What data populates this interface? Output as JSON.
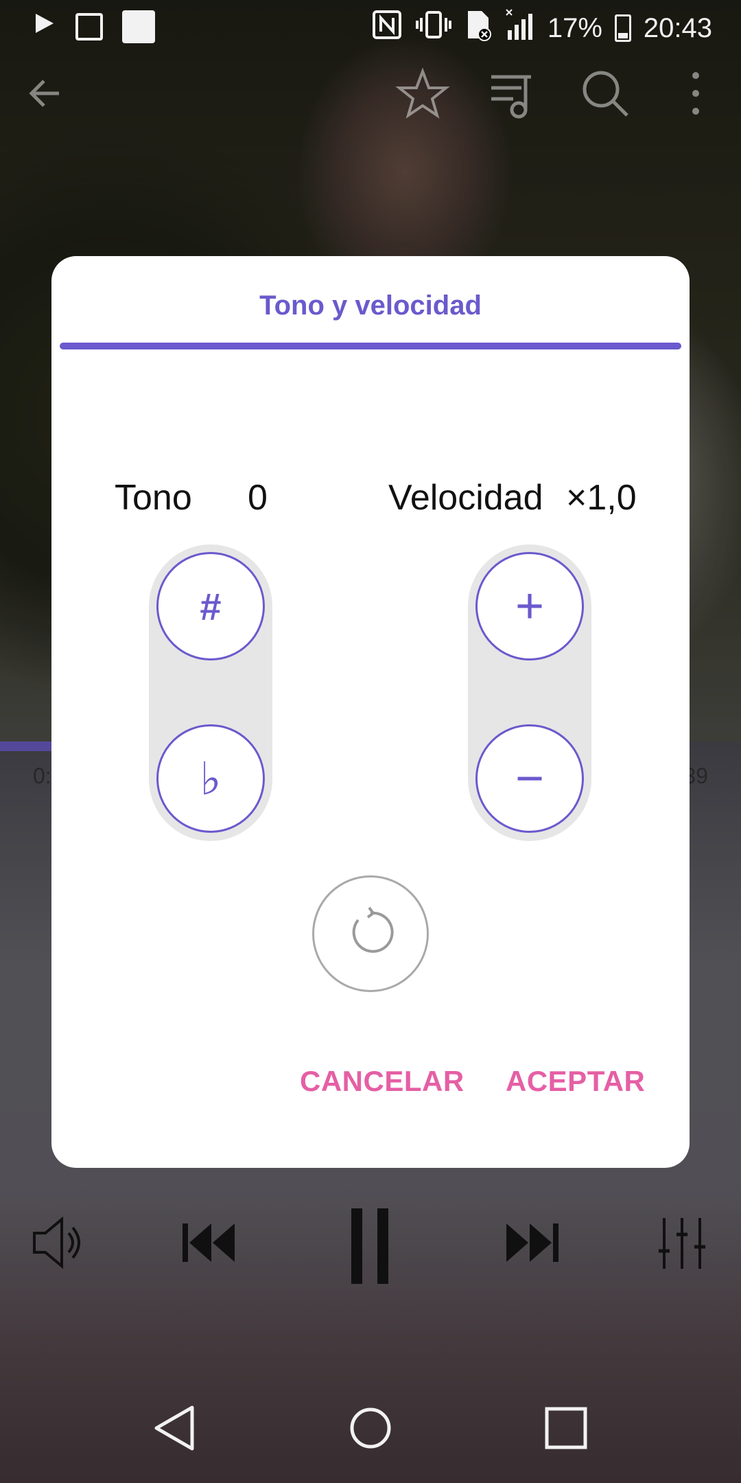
{
  "status_bar": {
    "battery": "17%",
    "time": "20:43"
  },
  "colors": {
    "accent": "#6a5acd",
    "action": "#e55fa5"
  },
  "player": {
    "time_elapsed": "0:",
    "time_total": "39"
  },
  "dialog": {
    "title": "Tono y velocidad",
    "tone_label": "Tono",
    "tone_value": "0",
    "speed_label": "Velocidad",
    "speed_value": "×1,0",
    "sharp_glyph": "#",
    "flat_glyph": "♭",
    "plus_glyph": "+",
    "minus_glyph": "−",
    "cancel": "CANCELAR",
    "accept": "ACEPTAR"
  }
}
